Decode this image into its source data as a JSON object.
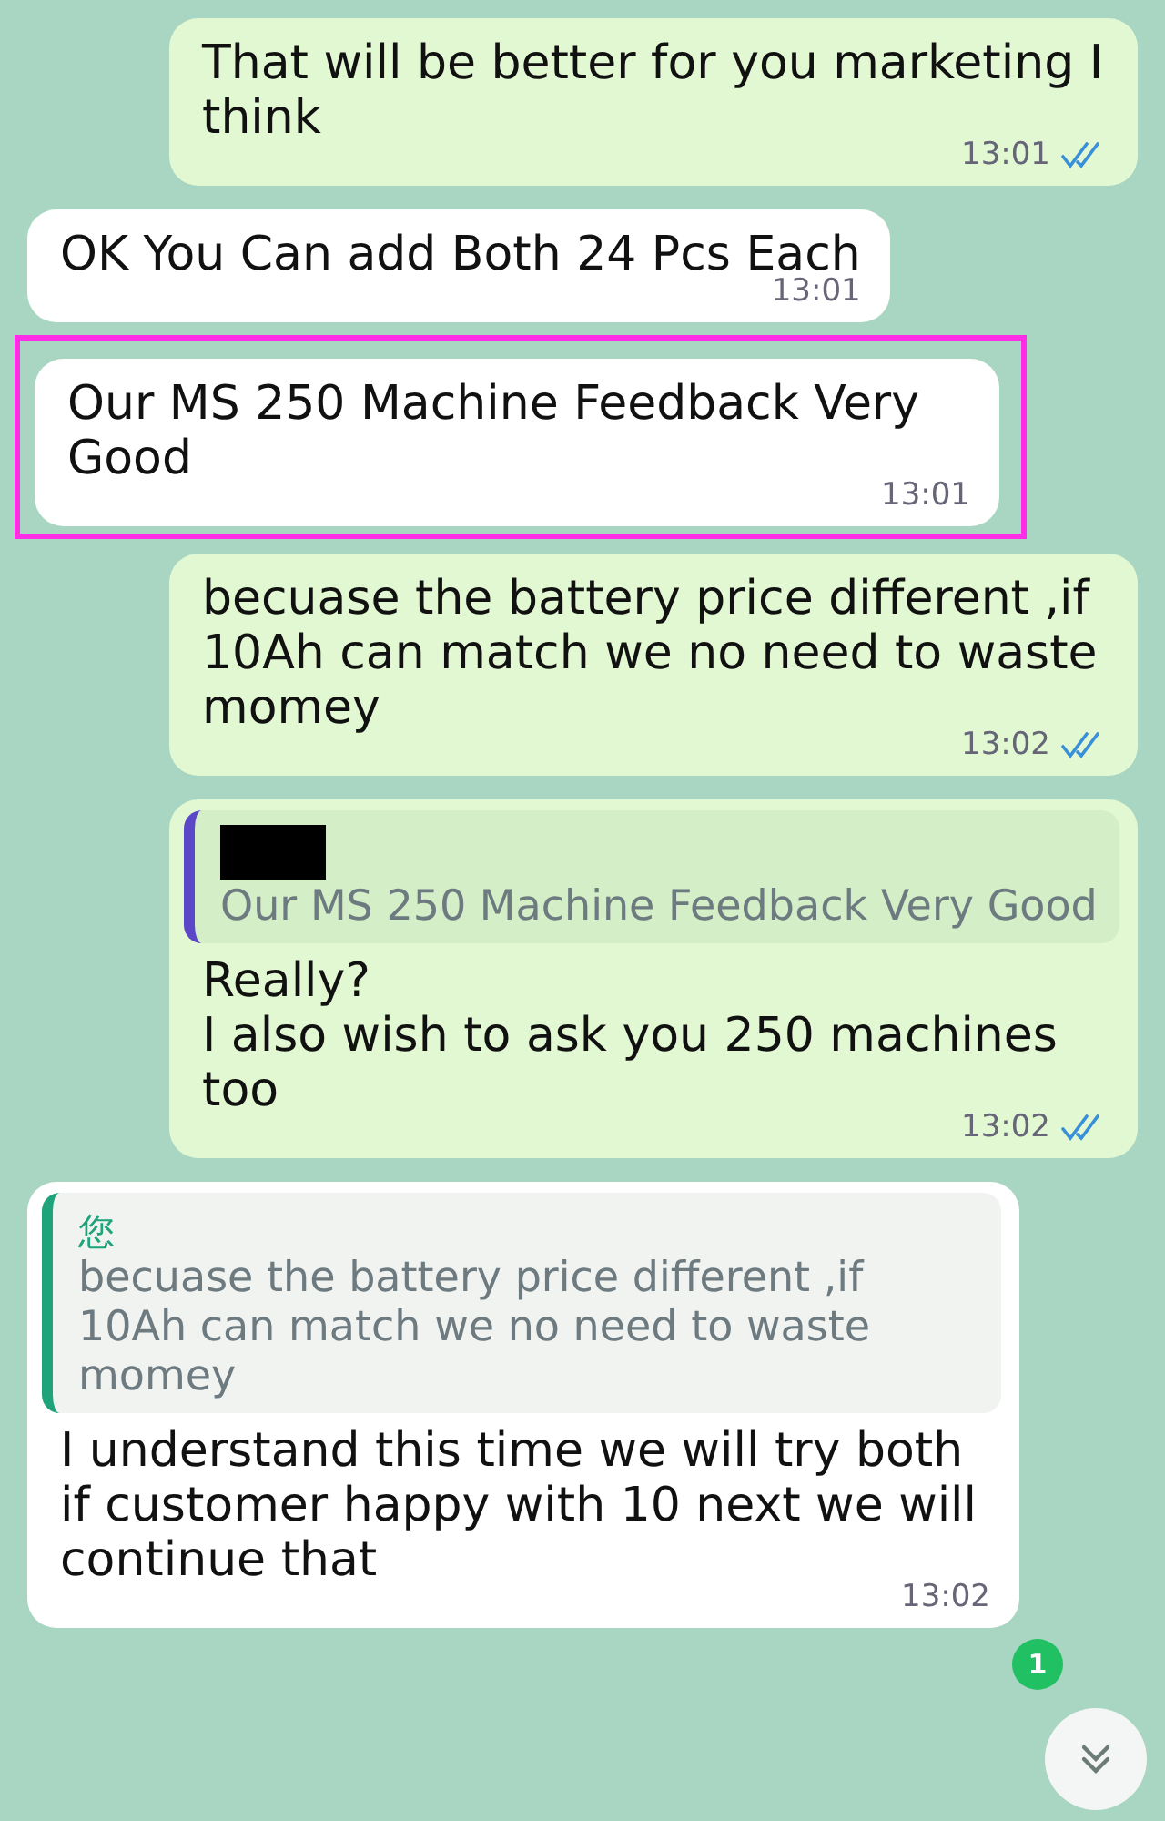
{
  "messages": [
    {
      "outgoing": true,
      "text": "That will be better for you marketing I think",
      "time": "13:01",
      "read": true,
      "highlighted": false
    },
    {
      "outgoing": false,
      "text": "OK You Can add Both 24 Pcs Each",
      "time": "13:01",
      "highlighted": false
    },
    {
      "outgoing": false,
      "text": "Our MS 250 Machine Feedback Very Good",
      "time": "13:01",
      "highlighted": true
    },
    {
      "outgoing": true,
      "text": "becuase the battery price different ,if 10Ah can match we no need to waste momey",
      "time": "13:02",
      "read": true,
      "highlighted": false
    },
    {
      "outgoing": true,
      "quote": {
        "author_redacted": true,
        "text": "Our MS 250 Machine Feedback Very Good"
      },
      "text": "Really?\nI also wish to ask you 250 machines too",
      "time": "13:02",
      "read": true,
      "highlighted": false
    },
    {
      "outgoing": false,
      "quote": {
        "author": "您",
        "author_redacted": false,
        "text": "becuase the battery price different ,if 10Ah can match we no need to waste momey"
      },
      "text": "I understand this time we will try both if customer happy with 10 next we will continue that",
      "time": "13:02",
      "highlighted": false
    }
  ],
  "unread_badge": "1"
}
